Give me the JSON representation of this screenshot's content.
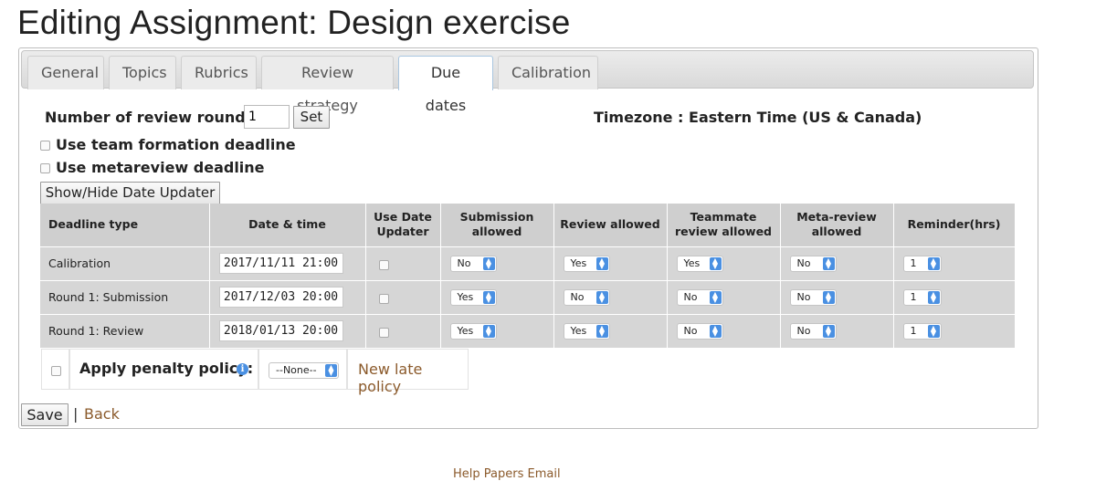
{
  "page": {
    "title": "Editing Assignment: Design exercise"
  },
  "tabs": [
    {
      "label": "General"
    },
    {
      "label": "Topics"
    },
    {
      "label": "Rubrics"
    },
    {
      "label": "Review strategy"
    },
    {
      "label": "Due dates",
      "active": true
    },
    {
      "label": "Calibration"
    }
  ],
  "rounds": {
    "label": "Number of review rounds:",
    "value": "1",
    "set_label": "Set"
  },
  "timezone": "Timezone : Eastern Time (US & Canada)",
  "options": {
    "team_formation": "Use team formation deadline",
    "metareview": "Use metareview deadline"
  },
  "toggle_button": "Show/Hide Date Updater",
  "table": {
    "headers": {
      "deadline_type": "Deadline type",
      "date_time": "Date & time",
      "use_date_updater": "Use Date Updater",
      "submission_allowed": "Submission allowed",
      "review_allowed": "Review allowed",
      "teammate_review_allowed": "Teammate review allowed",
      "meta_review_allowed": "Meta-review allowed",
      "reminder": "Reminder(hrs)"
    },
    "rows": [
      {
        "type": "Calibration",
        "datetime": "2017/11/11 21:00",
        "submission": "No",
        "review": "Yes",
        "teammate": "Yes",
        "meta": "No",
        "reminder": "1"
      },
      {
        "type": "Round 1: Submission",
        "datetime": "2017/12/03 20:00",
        "submission": "Yes",
        "review": "No",
        "teammate": "No",
        "meta": "No",
        "reminder": "1"
      },
      {
        "type": "Round 1: Review",
        "datetime": "2018/01/13 20:00",
        "submission": "Yes",
        "review": "Yes",
        "teammate": "No",
        "meta": "No",
        "reminder": "1"
      }
    ]
  },
  "penalty": {
    "label": "Apply penalty policy:",
    "select": "--None--",
    "new_link": "New late policy"
  },
  "actions": {
    "save": "Save",
    "separator": "|",
    "back": "Back"
  },
  "footer": {
    "links": "Help   Papers   Email"
  },
  "colors": {
    "link": "#8b5a2b",
    "select_arrow": "#4a90e2",
    "table_bg": "#d6d6d6"
  }
}
